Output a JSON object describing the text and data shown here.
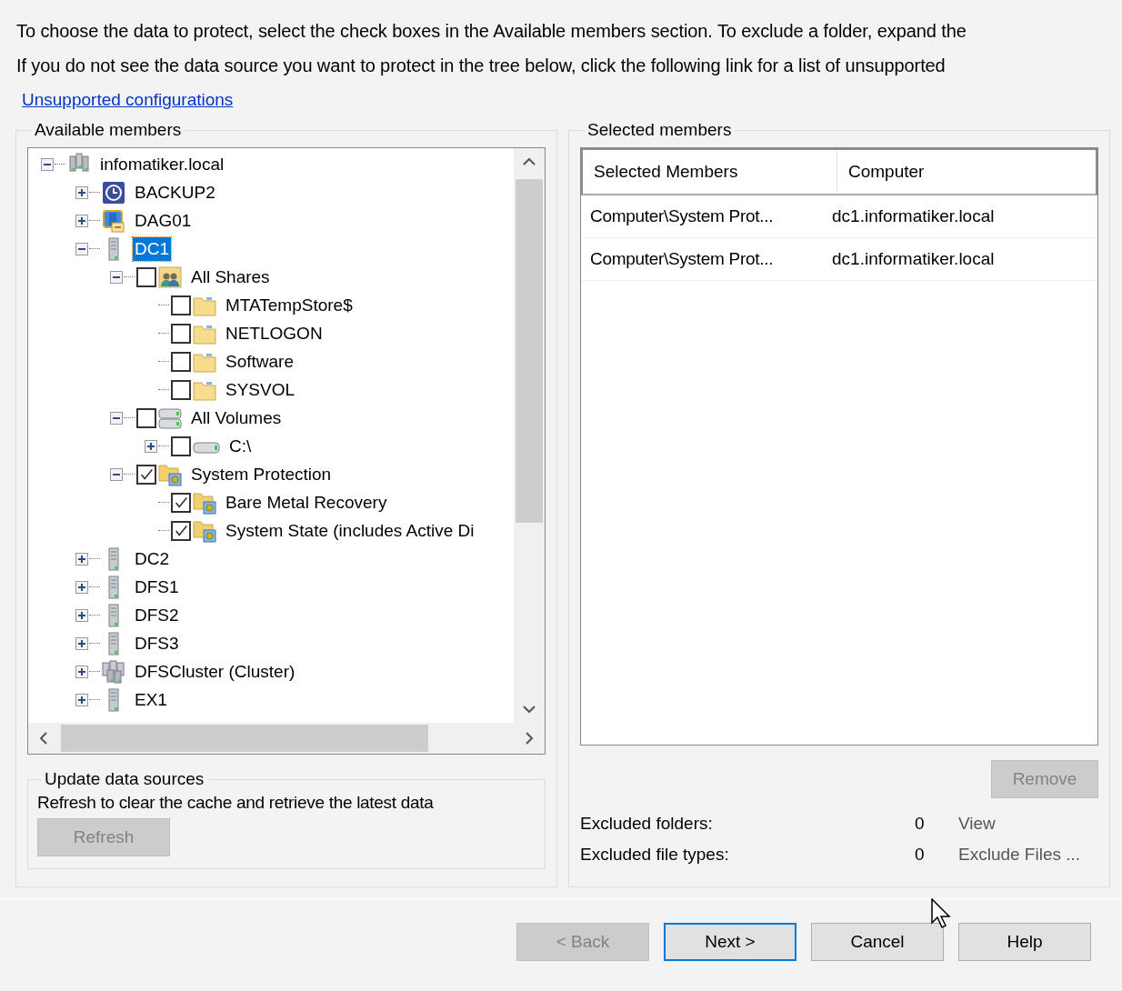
{
  "intro": {
    "lines": [
      "To choose the data to protect, select the check boxes in the Available members section. To exclude a folder, expand the",
      "If you do not see the data source you want to protect in the tree below, click the following link for a list of unsupported"
    ],
    "link": "Unsupported configurations"
  },
  "available": {
    "title": "Available members",
    "tree": [
      {
        "label": "infomatiker.local",
        "kind": "domain",
        "expanded": true,
        "selected": false,
        "children": [
          {
            "label": "BACKUP2",
            "kind": "backup",
            "expanded": false,
            "selected": false
          },
          {
            "label": "DAG01",
            "kind": "dag",
            "expanded": false,
            "selected": false
          },
          {
            "label": "DC1",
            "kind": "server",
            "expanded": true,
            "selected": true,
            "children": [
              {
                "label": "All Shares",
                "kind": "shares",
                "expanded": true,
                "checked": false,
                "selected": false,
                "children": [
                  {
                    "label": "MTATempStore$",
                    "kind": "folder",
                    "checked": false,
                    "selected": false
                  },
                  {
                    "label": "NETLOGON",
                    "kind": "folder",
                    "checked": false,
                    "selected": false
                  },
                  {
                    "label": "Software",
                    "kind": "folder",
                    "checked": false,
                    "selected": false
                  },
                  {
                    "label": "SYSVOL",
                    "kind": "folder",
                    "checked": false,
                    "selected": false
                  }
                ]
              },
              {
                "label": "All Volumes",
                "kind": "volumes",
                "expanded": true,
                "checked": false,
                "selected": false,
                "children": [
                  {
                    "label": "C:\\",
                    "kind": "drive",
                    "expanded": false,
                    "checked": false,
                    "selected": false
                  }
                ]
              },
              {
                "label": "System Protection",
                "kind": "sysprot",
                "expanded": true,
                "checked": true,
                "selected": false,
                "children": [
                  {
                    "label": "Bare Metal Recovery",
                    "kind": "sysprot",
                    "checked": true,
                    "selected": false
                  },
                  {
                    "label": "System State (includes Active Di",
                    "kind": "sysprot",
                    "checked": true,
                    "selected": false
                  }
                ]
              }
            ]
          },
          {
            "label": "DC2",
            "kind": "server",
            "expanded": false,
            "selected": false
          },
          {
            "label": "DFS1",
            "kind": "server",
            "expanded": false,
            "selected": false
          },
          {
            "label": "DFS2",
            "kind": "server",
            "expanded": false,
            "selected": false
          },
          {
            "label": "DFS3",
            "kind": "server",
            "expanded": false,
            "selected": false
          },
          {
            "label": "DFSCluster (Cluster)",
            "kind": "cluster",
            "expanded": false,
            "selected": false
          },
          {
            "label": "EX1",
            "kind": "server",
            "expanded": false,
            "selected": false
          }
        ]
      }
    ]
  },
  "update": {
    "title": "Update data sources",
    "text": "Refresh to clear the cache and retrieve the latest data",
    "button": {
      "label": "Refresh",
      "disabled": true
    }
  },
  "selected": {
    "title": "Selected members",
    "columns": [
      "Selected Members",
      "Computer"
    ],
    "rows": [
      [
        "Computer\\System  Prot...",
        "dc1.informatiker.local"
      ],
      [
        "Computer\\System  Prot...",
        "dc1.informatiker.local"
      ]
    ],
    "remove": {
      "label": "Remove",
      "disabled": true
    },
    "exclusions": [
      {
        "label": "Excluded folders:",
        "count": "0",
        "action": "View"
      },
      {
        "label": "Excluded file types:",
        "count": "0",
        "action": "Exclude Files ..."
      }
    ]
  },
  "buttons": [
    {
      "label": "< Back",
      "disabled": true,
      "focused": false
    },
    {
      "label": "Next >",
      "disabled": false,
      "focused": true
    },
    {
      "label": "Cancel",
      "disabled": false,
      "focused": false
    },
    {
      "label": "Help",
      "disabled": false,
      "focused": false
    }
  ]
}
